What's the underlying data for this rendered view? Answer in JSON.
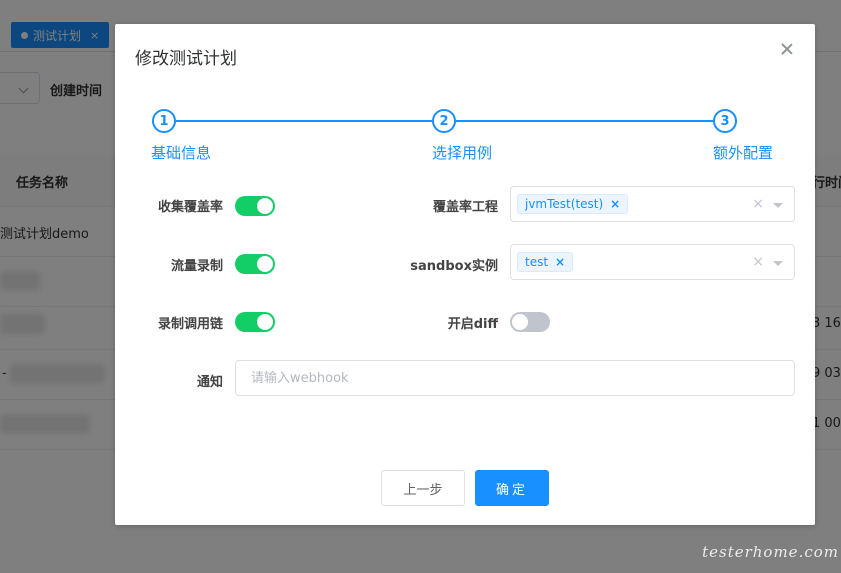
{
  "background": {
    "tab": {
      "label": "测试计划",
      "close": "×"
    },
    "filter": {
      "label": "创建时间"
    },
    "table": {
      "columns": {
        "name": "任务名称",
        "exec": "行时间"
      },
      "rows": [
        {
          "name": "测试计划demo",
          "right": ""
        },
        {
          "name": "",
          "right": ""
        },
        {
          "name": "",
          "right": "3 16:"
        },
        {
          "name": "-",
          "right": "9 03:"
        },
        {
          "name": "",
          "right": "1 00:"
        }
      ]
    }
  },
  "dialog": {
    "title": "修改测试计划",
    "steps": [
      {
        "number": "1",
        "label": "基础信息"
      },
      {
        "number": "2",
        "label": "选择用例"
      },
      {
        "number": "3",
        "label": "额外配置"
      }
    ],
    "form": {
      "coverage_label": "收集覆盖率",
      "coverage_on": true,
      "traffic_label": "流量录制",
      "traffic_on": true,
      "chain_label": "录制调用链",
      "chain_on": true,
      "coverage_project_label": "覆盖率工程",
      "coverage_project_tag": "jvmTest(test)",
      "sandbox_label": "sandbox实例",
      "sandbox_tag": "test",
      "diff_label": "开启diff",
      "diff_on": false,
      "notify_label": "通知",
      "notify_placeholder": "请输入webhook",
      "notify_value": ""
    },
    "buttons": {
      "prev": "上一步",
      "confirm": "确定"
    }
  },
  "watermark": "testerhome.com",
  "colors": {
    "primary": "#1890ff",
    "switch_on": "#13ce66",
    "switch_off": "#c0c4cc"
  }
}
